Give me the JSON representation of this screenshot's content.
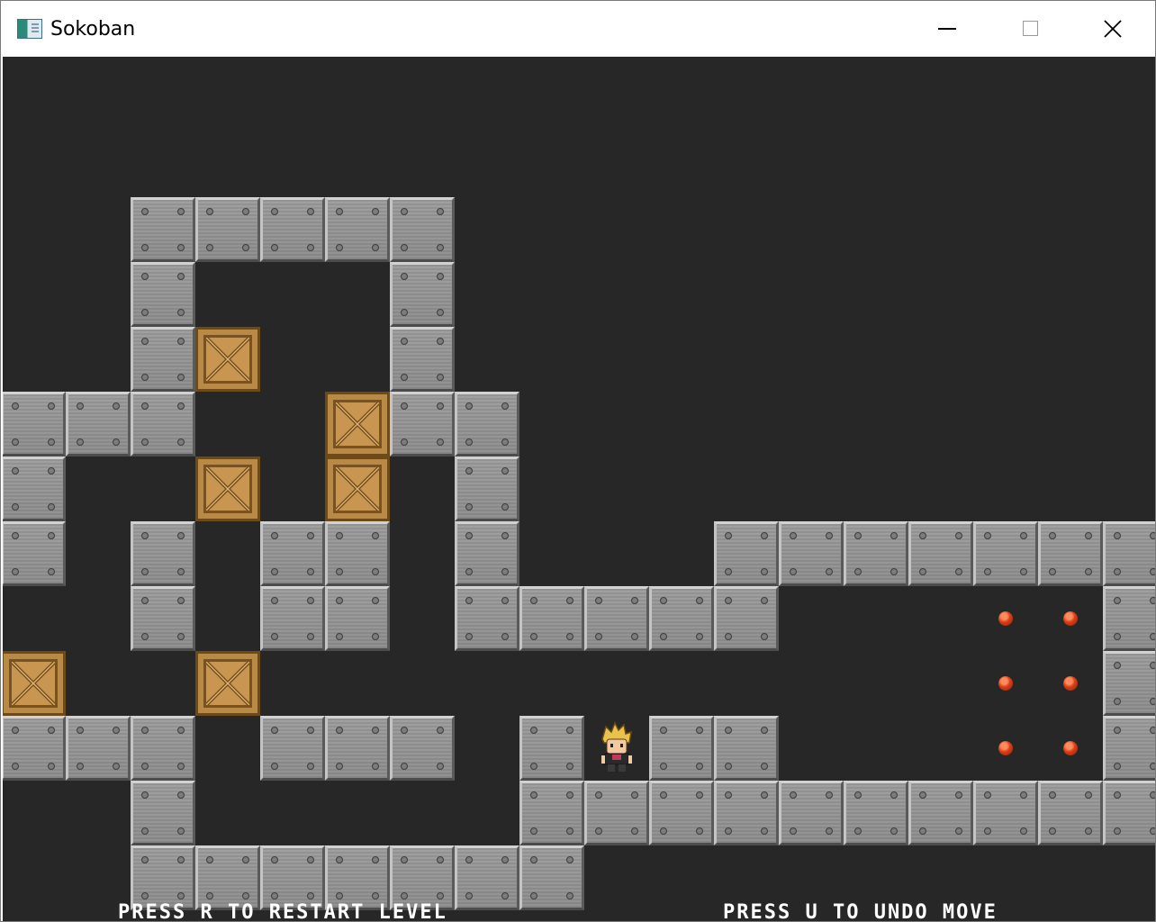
{
  "window": {
    "title": "Sokoban",
    "controls": [
      "minimize",
      "maximize",
      "close"
    ],
    "icons": {
      "app": "app-window-icon",
      "minimize": "minimize-icon",
      "maximize": "maximize-icon",
      "close": "close-icon"
    }
  },
  "game": {
    "background_color": "#272727",
    "grid": {
      "cols": 18,
      "rows": 13
    },
    "legend": {
      "#": "wall",
      "$": "crate",
      ".": "goal",
      "@": "player",
      " ": "floor"
    },
    "map": [
      "                  ",
      "  #####           ",
      "  #   #           ",
      "  #$  #           ",
      "###  $##          ",
      "#  $ $ #          ",
      "#  ## #    #######",
      "  # ## #####   . .#",
      "$  $           . .#",
      "### ### #@##   . .#",
      "  #     #########",
      "  #######         "
    ],
    "walls": [
      [
        2,
        1
      ],
      [
        3,
        1
      ],
      [
        4,
        1
      ],
      [
        5,
        1
      ],
      [
        6,
        1
      ],
      [
        2,
        2
      ],
      [
        6,
        2
      ],
      [
        2,
        3
      ],
      [
        6,
        3
      ],
      [
        0,
        4
      ],
      [
        1,
        4
      ],
      [
        2,
        4
      ],
      [
        6,
        4
      ],
      [
        7,
        4
      ],
      [
        0,
        5
      ],
      [
        7,
        5
      ],
      [
        0,
        6
      ],
      [
        2,
        6
      ],
      [
        4,
        6
      ],
      [
        5,
        6
      ],
      [
        7,
        6
      ],
      [
        11,
        6
      ],
      [
        12,
        6
      ],
      [
        13,
        6
      ],
      [
        14,
        6
      ],
      [
        15,
        6
      ],
      [
        16,
        6
      ],
      [
        17,
        6
      ],
      [
        2,
        7
      ],
      [
        4,
        7
      ],
      [
        5,
        7
      ],
      [
        7,
        7
      ],
      [
        8,
        7
      ],
      [
        9,
        7
      ],
      [
        10,
        7
      ],
      [
        11,
        7
      ],
      [
        17,
        7
      ],
      [
        17,
        8
      ],
      [
        0,
        9
      ],
      [
        1,
        9
      ],
      [
        2,
        9
      ],
      [
        4,
        9
      ],
      [
        5,
        9
      ],
      [
        6,
        9
      ],
      [
        8,
        9
      ],
      [
        10,
        9
      ],
      [
        11,
        9
      ],
      [
        17,
        9
      ],
      [
        2,
        10
      ],
      [
        8,
        10
      ],
      [
        9,
        10
      ],
      [
        10,
        10
      ],
      [
        11,
        10
      ],
      [
        12,
        10
      ],
      [
        13,
        10
      ],
      [
        14,
        10
      ],
      [
        15,
        10
      ],
      [
        16,
        10
      ],
      [
        17,
        10
      ],
      [
        2,
        11
      ],
      [
        3,
        11
      ],
      [
        4,
        11
      ],
      [
        5,
        11
      ],
      [
        6,
        11
      ],
      [
        7,
        11
      ],
      [
        8,
        11
      ]
    ],
    "crates": [
      [
        3,
        3
      ],
      [
        5,
        4
      ],
      [
        3,
        5
      ],
      [
        5,
        5
      ],
      [
        0,
        8
      ],
      [
        3,
        8
      ]
    ],
    "goals": [
      [
        15,
        7
      ],
      [
        16,
        7
      ],
      [
        15,
        8
      ],
      [
        16,
        8
      ],
      [
        15,
        9
      ],
      [
        16,
        9
      ]
    ],
    "player": [
      9,
      9
    ],
    "colors": {
      "wall": "#8f8f8f",
      "crate": "#b98a45",
      "goal": "#d8401a"
    }
  },
  "hints": {
    "restart": "PRESS R TO RESTART LEVEL",
    "undo": "PRESS U TO UNDO MOVE"
  }
}
